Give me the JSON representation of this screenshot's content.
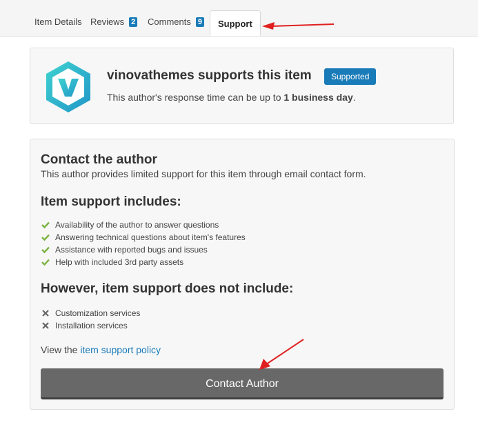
{
  "tabs": [
    {
      "label": "Item Details"
    },
    {
      "label": "Reviews",
      "badge": "2"
    },
    {
      "label": "Comments",
      "badge": "9"
    },
    {
      "label": "Support"
    }
  ],
  "author": {
    "title": "vinovathemes supports this item",
    "badge": "Supported",
    "response_prefix": "This author's response time can be up to ",
    "response_bold": "1 business day",
    "response_suffix": "."
  },
  "support": {
    "contact_heading": "Contact the author",
    "contact_text": "This author provides limited support for this item through email contact form.",
    "includes_heading": "Item support includes:",
    "includes": [
      "Availability of the author to answer questions",
      "Answering technical questions about item's features",
      "Assistance with reported bugs and issues",
      "Help with included 3rd party assets"
    ],
    "excludes_heading": "However, item support does not include:",
    "excludes": [
      "Customization services",
      "Installation services"
    ],
    "policy_prefix": "View the ",
    "policy_link": "item support policy",
    "button_label": "Contact Author"
  },
  "colors": {
    "accent": "#1a7bb9",
    "check": "#7cb342",
    "annotation_arrow": "#e02020",
    "button": "#686868"
  },
  "icons": {
    "logo": "v-hexagon-logo",
    "included": "check-icon",
    "excluded": "x-icon",
    "annotations": "red-arrow"
  }
}
